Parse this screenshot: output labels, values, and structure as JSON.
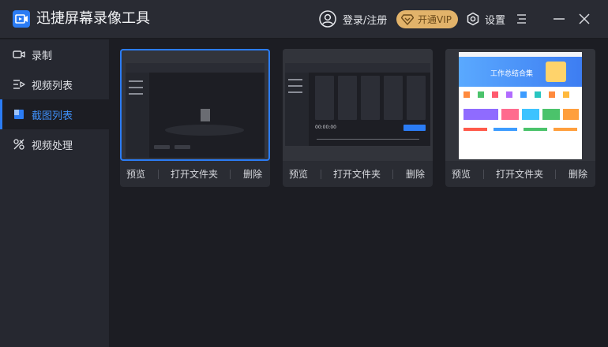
{
  "app": {
    "title": "迅捷屏幕录像工具"
  },
  "header": {
    "login_label": "登录/注册",
    "vip_label": "开通VIP",
    "settings_label": "设置"
  },
  "sidebar": {
    "items": [
      {
        "label": "录制",
        "icon": "record-icon"
      },
      {
        "label": "视频列表",
        "icon": "video-list-icon"
      },
      {
        "label": "截图列表",
        "icon": "screenshot-list-icon",
        "active": true
      },
      {
        "label": "视频处理",
        "icon": "video-process-icon"
      }
    ]
  },
  "cards": [
    {
      "actions": {
        "preview": "预览",
        "open_folder": "打开文件夹",
        "delete": "删除"
      },
      "selected": true
    },
    {
      "actions": {
        "preview": "预览",
        "open_folder": "打开文件夹",
        "delete": "删除"
      }
    },
    {
      "actions": {
        "preview": "预览",
        "open_folder": "打开文件夹",
        "delete": "删除"
      }
    }
  ],
  "thumbnails": {
    "second_time": "00:00:00",
    "third_banner": "工作总结合集"
  },
  "colors": {
    "accent": "#2b7cf4",
    "vip_gold": "#e2b36a",
    "background": "#1c1d23",
    "sidebar": "#262830",
    "titlebar": "#292b33"
  }
}
